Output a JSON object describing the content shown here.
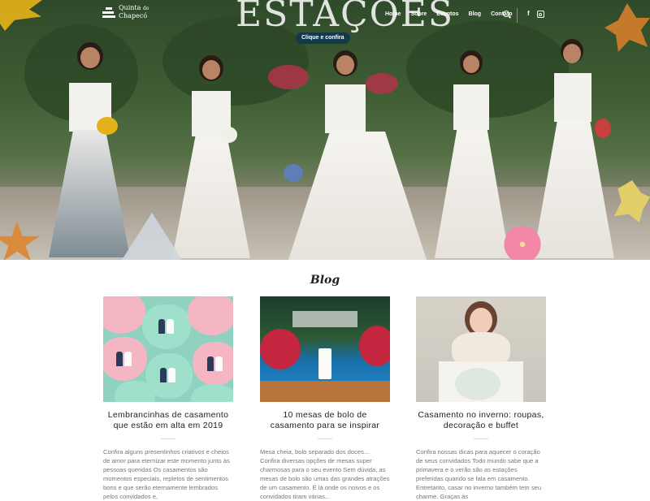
{
  "header": {
    "logo": {
      "line1": "Quinta",
      "line1_small": "do",
      "line2": "Chapecó"
    },
    "brand_title": "ESTAÇÕES",
    "nav": [
      "Home",
      "Sobre",
      "Eventos",
      "Blog",
      "Contato"
    ],
    "social": {
      "facebook_glyph": "f"
    },
    "icons": [
      "search-icon",
      "facebook-icon",
      "instagram-icon"
    ]
  },
  "hero": {
    "cta_label": "Clique e confira"
  },
  "blog": {
    "heading": "Blog",
    "posts": [
      {
        "title": "Lembrancinhas de casamento que estão em alta em 2019",
        "excerpt": "Confira alguns presentinhos criativos e cheios de amor para eternizar este momento junto às pessoas queridas  Os casamentos são momentos especiais, repletos de sentimentos bons e que serão eternamente lembrados pelos convidados e,"
      },
      {
        "title": "10 mesas de bolo de casamento para se inspirar",
        "excerpt": "Mesa cheia, bolo separado dos doces... Confira diversas opções de mesas super charmosas para o seu evento Sem dúvida, as mesas de bolo são umas das grandes atrações de um casamento. É lá onde os noivos e os convidados tiram várias..."
      },
      {
        "title": "Casamento no inverno: roupas, decoração e buffet",
        "excerpt": "Confira nossas dicas para aquecer o coração de seus convidados  Todo mundo sabe que a primavera e o verão são as estações preferidas quando se fala em casamento. Entretanto, casar no inverno também tem seu charme. Graças às"
      }
    ]
  }
}
